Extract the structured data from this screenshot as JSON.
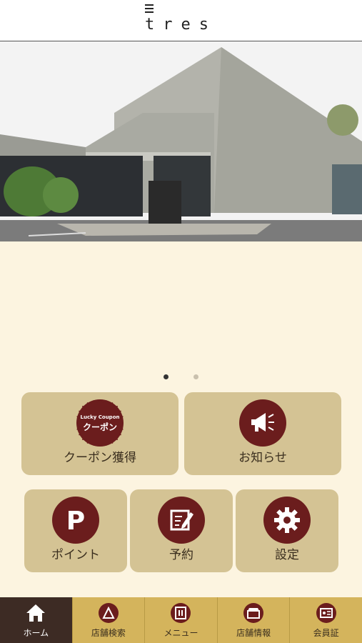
{
  "app": {
    "logo": "tres"
  },
  "tiles": [
    {
      "label": "クーポン獲得",
      "badge_top": "Lucky Coupon",
      "badge_main": "クーポン"
    },
    {
      "label": "お知らせ"
    },
    {
      "label": "ポイント"
    },
    {
      "label": "予約"
    },
    {
      "label": "設定"
    }
  ],
  "tabs": [
    {
      "label": "ホーム",
      "icon": "home-icon"
    },
    {
      "label": "店舗検索",
      "icon": "store-search-icon"
    },
    {
      "label": "メニュー",
      "icon": "menu-icon"
    },
    {
      "label": "店舗情報",
      "icon": "store-info-icon"
    },
    {
      "label": "会員証",
      "icon": "member-card-icon"
    }
  ],
  "carousel": {
    "current": 1,
    "total": 2
  },
  "colors": {
    "accent": "#6b1d1d",
    "tile": "#d4c394",
    "tabbar": "#d4b45c",
    "background": "#fcf4e0"
  }
}
